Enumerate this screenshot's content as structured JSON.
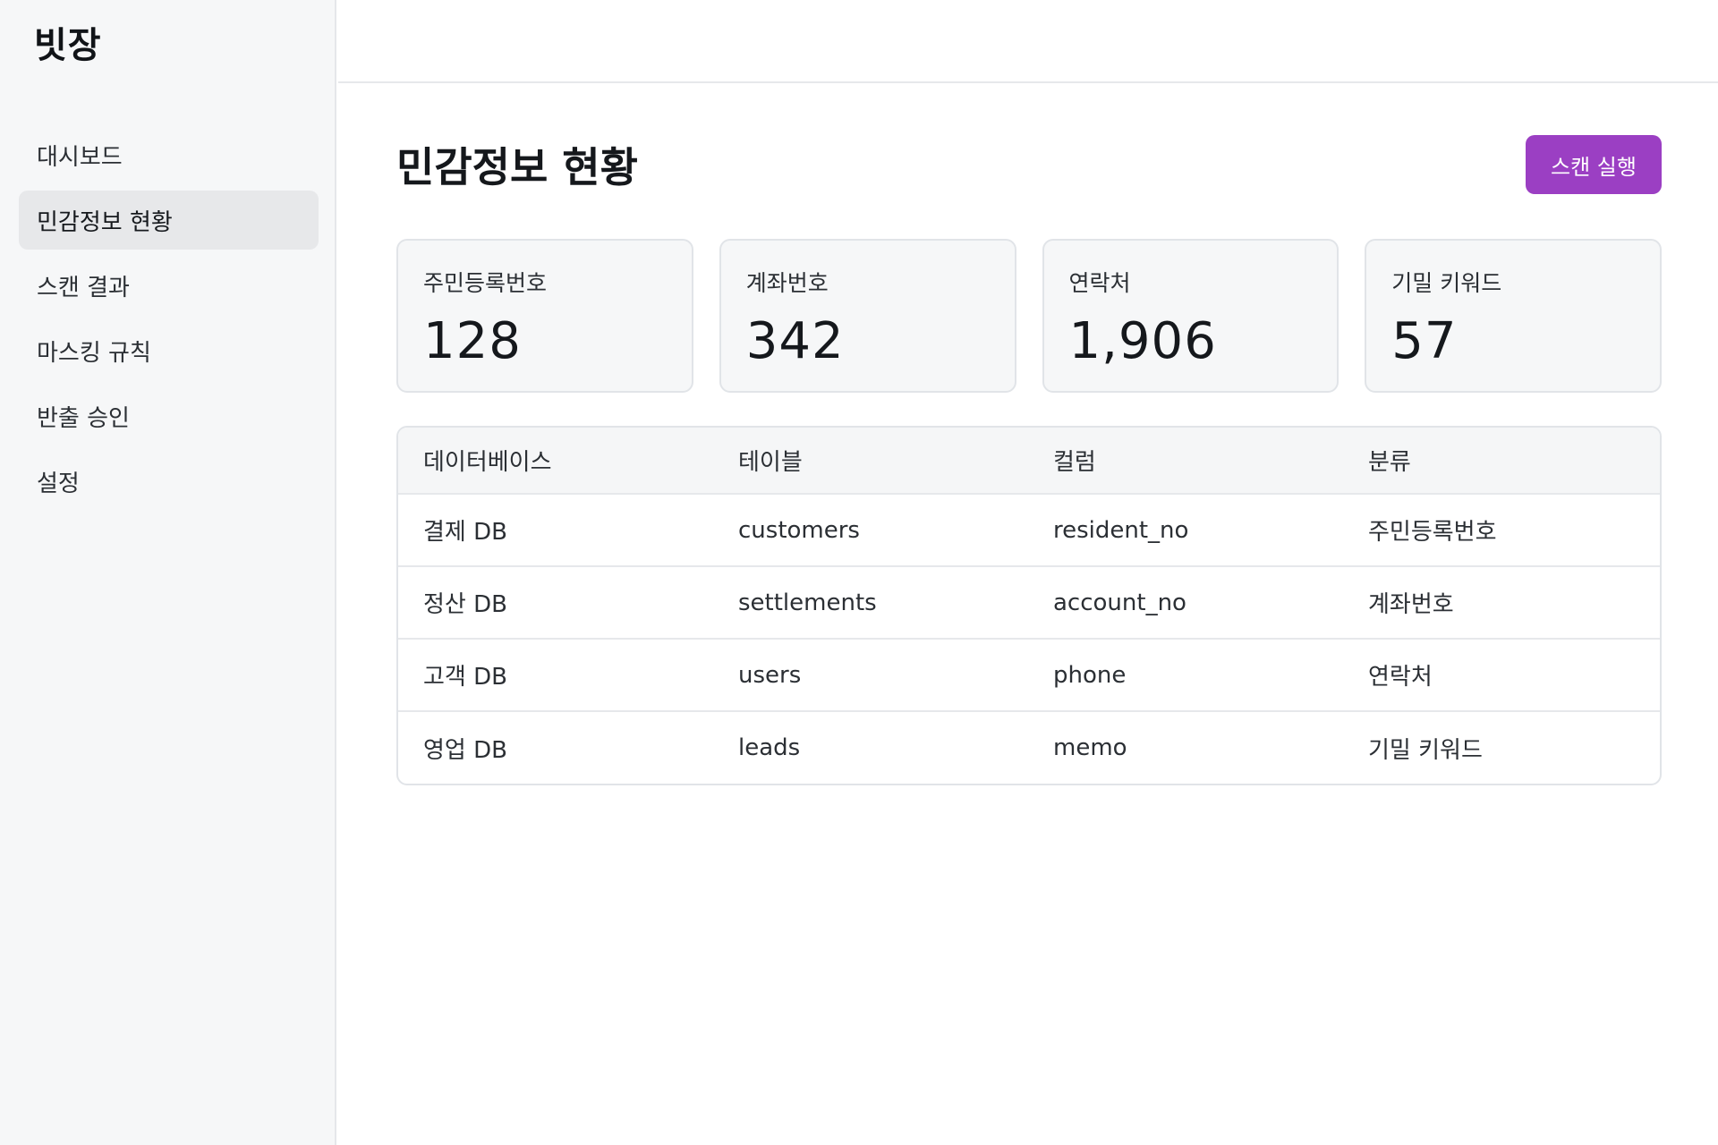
{
  "app": {
    "brand": "빗장"
  },
  "sidebar": {
    "items": [
      {
        "label": "대시보드",
        "active": false
      },
      {
        "label": "민감정보 현황",
        "active": true
      },
      {
        "label": "스캔 결과",
        "active": false
      },
      {
        "label": "마스킹 규칙",
        "active": false
      },
      {
        "label": "반출 승인",
        "active": false
      },
      {
        "label": "설정",
        "active": false
      }
    ]
  },
  "main": {
    "title": "민감정보 현황",
    "scan_button": "스캔 실행",
    "accent_color": "#9b3fc3",
    "stats": [
      {
        "label": "주민등록번호",
        "value": "128"
      },
      {
        "label": "계좌번호",
        "value": "342"
      },
      {
        "label": "연락처",
        "value": "1,906"
      },
      {
        "label": "기밀 키워드",
        "value": "57"
      }
    ],
    "table": {
      "headers": [
        "데이터베이스",
        "테이블",
        "컬럼",
        "분류"
      ],
      "rows": [
        [
          "결제 DB",
          "customers",
          "resident_no",
          "주민등록번호"
        ],
        [
          "정산 DB",
          "settlements",
          "account_no",
          "계좌번호"
        ],
        [
          "고객 DB",
          "users",
          "phone",
          "연락처"
        ],
        [
          "영업 DB",
          "leads",
          "memo",
          "기밀 키워드"
        ]
      ]
    }
  }
}
